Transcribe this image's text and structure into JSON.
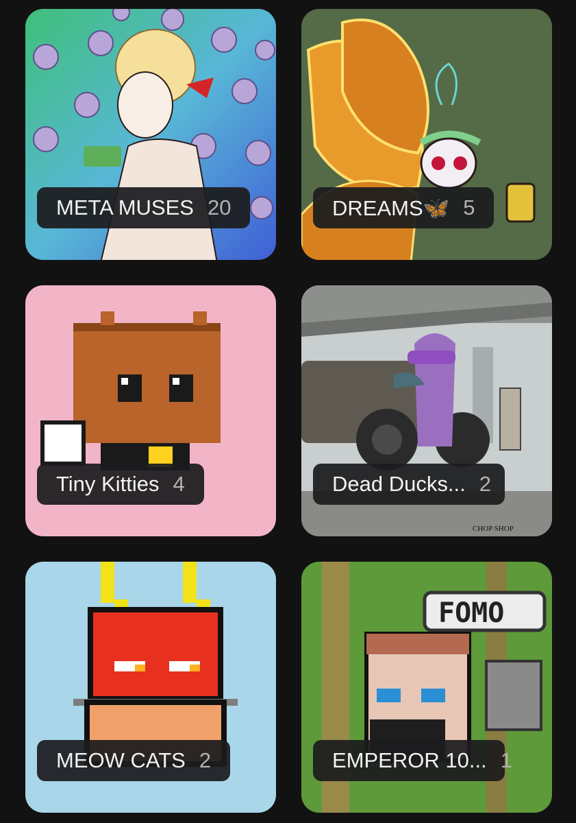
{
  "collections": [
    {
      "name": "META MUSES",
      "count": "20",
      "background": "#4a9fd0"
    },
    {
      "name": "DREAMS🦋",
      "count": "5",
      "background": "#556b47"
    },
    {
      "name": "Tiny Kitties",
      "count": "4",
      "background": "#f2b5c8"
    },
    {
      "name": "Dead Ducks...",
      "count": "2",
      "background": "#9aa4a8"
    },
    {
      "name": "MEOW CATS",
      "count": "2",
      "background": "#a9d6e8"
    },
    {
      "name": "EMPEROR 10...",
      "count": "1",
      "background": "#5f9a3a"
    }
  ],
  "colors": {
    "page_background": "#121212",
    "label_background": "#1c1c1e",
    "label_text": "#f2f2f2",
    "count_text": "#b3b3b3"
  }
}
